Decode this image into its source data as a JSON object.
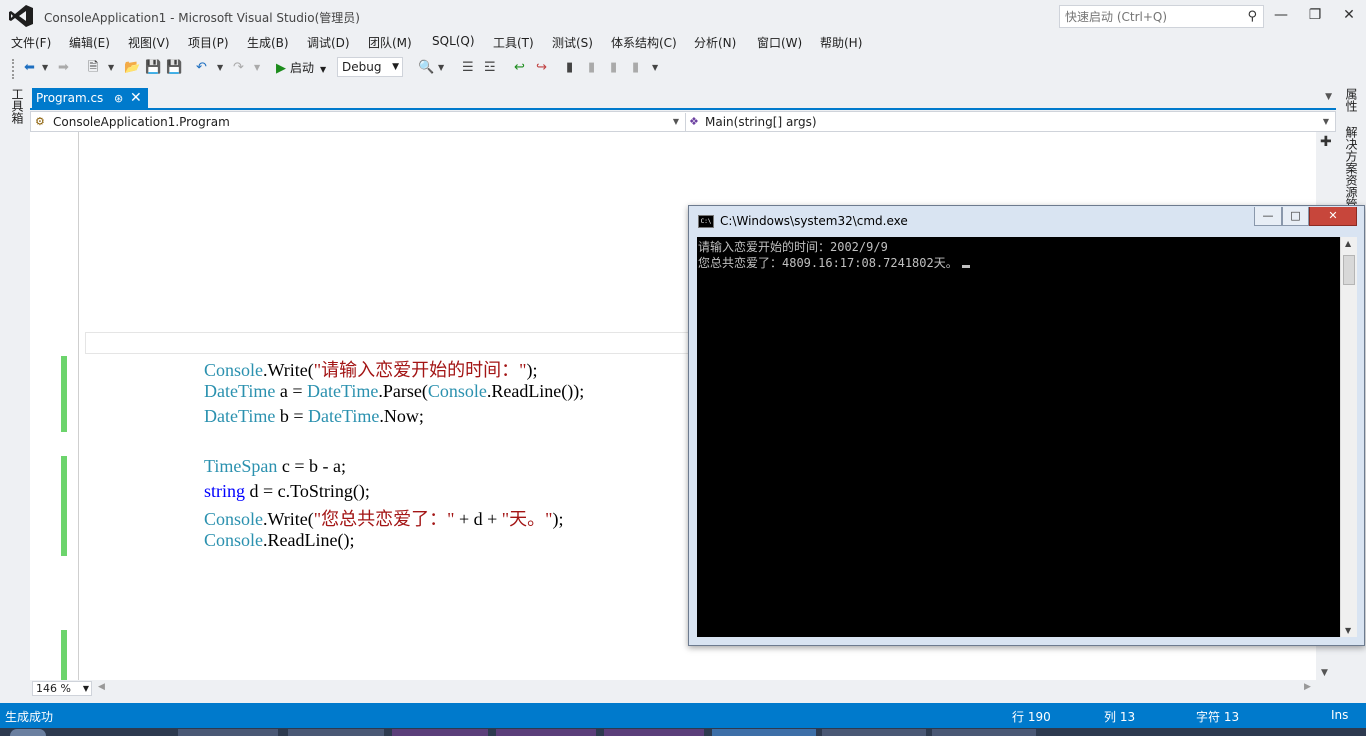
{
  "window": {
    "title": "ConsoleApplication1 - Microsoft Visual Studio(管理员)",
    "quick_launch_placeholder": "快速启动 (Ctrl+Q)"
  },
  "menu": [
    "文件(F)",
    "编辑(E)",
    "视图(V)",
    "项目(P)",
    "生成(B)",
    "调试(D)",
    "团队(M)",
    "SQL(Q)",
    "工具(T)",
    "测试(S)",
    "体系结构(C)",
    "分析(N)",
    "窗口(W)",
    "帮助(H)"
  ],
  "toolbar": {
    "start_label": "启动",
    "config": "Debug"
  },
  "side_panels": {
    "left": "工具箱",
    "right_top": "属性",
    "right_bottom": "解决方案资源管理器"
  },
  "tabs": [
    {
      "label": "Program.cs"
    }
  ],
  "navbar": {
    "type": "ConsoleApplication1.Program",
    "member": "Main(string[] args)"
  },
  "code": {
    "l1": {
      "cls": "Console",
      "call": ".Write(",
      "str": "\"请输入恋爱开始的时间：\"",
      "end": ");"
    },
    "l2": {
      "type": "DateTime",
      "mid": " a = ",
      "type2": "DateTime",
      "call": ".Parse(",
      "cls": "Console",
      "end": ".ReadLine());"
    },
    "l3": {
      "type": "DateTime",
      "mid": " b = ",
      "type2": "DateTime",
      "end": ".Now;"
    },
    "l4": {
      "type": "TimeSpan",
      "end": " c = b - a;"
    },
    "l5": {
      "kw": "string",
      "end": " d = c.ToString();"
    },
    "l6": {
      "cls": "Console",
      "call": ".Write(",
      "str1": "\"您总共恋爱了：\"",
      "mid": " + d + ",
      "str2": "\"天。\"",
      "end": ");"
    },
    "l7": {
      "cls": "Console",
      "end": ".ReadLine();"
    }
  },
  "zoom": "146 %",
  "status": {
    "message": "生成成功",
    "line": "行 190",
    "col": "列 13",
    "char": "字符 13",
    "mode": "Ins"
  },
  "console": {
    "title": "C:\\Windows\\system32\\cmd.exe",
    "icon_text": "C:\\",
    "lines": [
      "请输入恋爱开始的时间：2002/9/9",
      "您总共恋爱了：4809.16:17:08.7241802天。"
    ]
  },
  "colors": {
    "accent": "#007acc",
    "type": "#2b91af",
    "keyword": "#0000ff",
    "string": "#a31515",
    "change_marker": "#6cd46c"
  }
}
